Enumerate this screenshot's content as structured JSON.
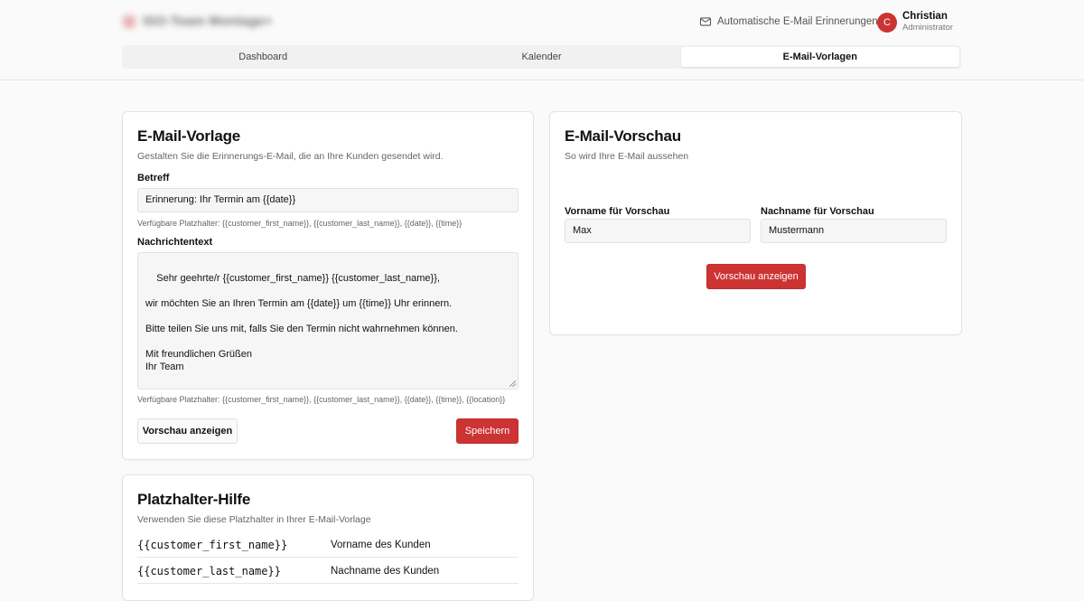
{
  "header": {
    "brand": "ISO-Team Montage+",
    "reminders_label": "Automatische E-Mail Erinnerungen",
    "reminders_icon": "mail-icon",
    "user": {
      "initial": "C",
      "name": "Christian",
      "role": "Administrator"
    },
    "accent": "#cc3333"
  },
  "tabs": [
    {
      "label": "Dashboard",
      "active": false
    },
    {
      "label": "Kalender",
      "active": false
    },
    {
      "label": "E-Mail-Vorlagen",
      "active": true
    }
  ],
  "template_card": {
    "title": "E-Mail-Vorlage",
    "subtitle": "Gestalten Sie die Erinnerungs-E-Mail, die an Ihre Kunden gesendet wird.",
    "subject_label": "Betreff",
    "subject_value": "Erinnerung: Ihr Termin am {{date}}",
    "subject_hint": "Verfügbare Platzhalter: {{customer_first_name}}, {{customer_last_name}}, {{date}}, {{time}}",
    "body_label": "Nachrichtentext",
    "body_value": "Sehr geehrte/r {{customer_first_name}} {{customer_last_name}},\n\nwir möchten Sie an Ihren Termin am {{date}} um {{time}} Uhr erinnern.\n\nBitte teilen Sie uns mit, falls Sie den Termin nicht wahrnehmen können.\n\nMit freundlichen Grüßen\nIhr Team",
    "body_hint": "Verfügbare Platzhalter: {{customer_first_name}}, {{customer_last_name}}, {{date}}, {{time}}, {{location}}",
    "preview_button": "Vorschau anzeigen",
    "save_button": "Speichern"
  },
  "preview_card": {
    "title": "E-Mail-Vorschau",
    "subtitle": "So wird Ihre E-Mail aussehen",
    "first_name_label": "Vorname für Vorschau",
    "first_name_value": "Max",
    "last_name_label": "Nachname für Vorschau",
    "last_name_value": "Mustermann",
    "preview_button": "Vorschau anzeigen"
  },
  "help_card": {
    "title": "Platzhalter-Hilfe",
    "subtitle": "Verwenden Sie diese Platzhalter in Ihrer E-Mail-Vorlage",
    "rows": [
      {
        "code": "{{customer_first_name}}",
        "desc": "Vorname des Kunden"
      },
      {
        "code": "{{customer_last_name}}",
        "desc": "Nachname des Kunden"
      }
    ]
  }
}
